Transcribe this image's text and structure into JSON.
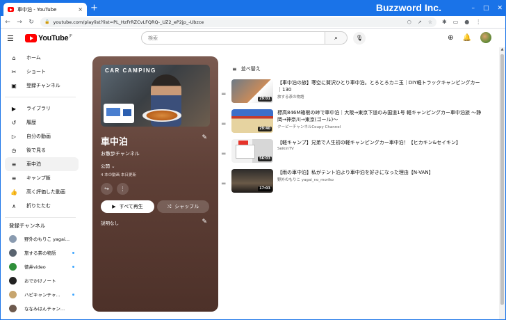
{
  "browser": {
    "tab_title": "車中泊 - YouTube",
    "tab_close": "×",
    "new_tab": "+",
    "brand": "Buzzword Inc.",
    "url": "youtube.com/playlist?list=PL_HzFrRZCvLFQRQ-_UZ2_eP2jp_-Ubzce",
    "lock": "🔒",
    "back": "←",
    "forward": "→",
    "reload": "↻",
    "min": "–",
    "max": "□",
    "close": "✕",
    "url_icons": [
      "⬡",
      "↗",
      "☆"
    ],
    "right_icons": [
      "✱",
      "▭",
      "●",
      "⋮"
    ]
  },
  "header": {
    "menu": "☰",
    "logo_text": "YouTube",
    "logo_sup": "JP",
    "search_placeholder": "検索",
    "search_icon": "⌕",
    "mic_icon": "🎙",
    "create_icon": "⊕",
    "bell_icon": "🔔"
  },
  "sidebar": {
    "main": [
      {
        "icon": "⌂",
        "label": "ホーム"
      },
      {
        "icon": "✂",
        "label": "ショート"
      },
      {
        "icon": "▣",
        "label": "登録チャンネル"
      }
    ],
    "library": [
      {
        "icon": "▶",
        "label": "ライブラリ"
      },
      {
        "icon": "↺",
        "label": "履歴"
      },
      {
        "icon": "▷",
        "label": "自分の動画"
      },
      {
        "icon": "◷",
        "label": "後で見る"
      },
      {
        "icon": "≡",
        "label": "車中泊"
      },
      {
        "icon": "≡",
        "label": "キャンプ飯"
      },
      {
        "icon": "👍",
        "label": "高く評価した動画"
      },
      {
        "icon": "∧",
        "label": "折りたたむ"
      }
    ],
    "subs_heading": "登録チャンネル",
    "subs": [
      {
        "label": "野外のもりこ yagai...",
        "color": "#8a9bb0",
        "dot": false
      },
      {
        "label": "旅する茶の物語",
        "color": "#5a6470",
        "dot": true
      },
      {
        "label": "徳井video",
        "color": "#2f8f3a",
        "dot": true
      },
      {
        "label": "おでかけノート",
        "color": "#222222",
        "dot": false
      },
      {
        "label": "ハピキャンチャ...",
        "color": "#c7a56e",
        "dot": true
      },
      {
        "label": "ななみはんチャン...",
        "color": "#6d5a4e",
        "dot": false
      }
    ]
  },
  "playlist": {
    "hero_text": "CAR CAMPING",
    "title": "車中泊",
    "edit_icon": "✎",
    "owner": "お散歩チャンネル",
    "privacy": "公開 ⌄",
    "meta": "4 本の動画 本日更新",
    "share_icon": "↪",
    "more_icon": "⋮",
    "play_all": "すべて再生",
    "play_icon": "▶",
    "shuffle": "シャッフル",
    "shuffle_icon": "⤮",
    "description": "説明なし"
  },
  "list": {
    "sort_icon": "≡",
    "sort_label": "並べ替え",
    "handle": "═",
    "videos": [
      {
        "title": "【車中泊の旅】寒空に贅沢ひとり車中泊。とろとろカニ玉｜DIY軽トラックキャンピングカー｜130",
        "channel": "旅する茶の物語",
        "duration": "29:01"
      },
      {
        "title": "標高846M箱根の峠で車中泊｜大阪→東京下道のみ国道1号 軽キャンピングカー車中泊旅 〜静岡→神奈川→東京(ゴール)〜",
        "channel": "クーピーチャンネルCoupy Channel",
        "duration": "29:40"
      },
      {
        "title": "【軽キャンプ】兄弟で人生初の軽キャンピングカー車中泊！【ヒカキン&セイキン】",
        "channel": "SeikinTV",
        "duration": "56:03"
      },
      {
        "title": "【雨の車中泊】私がテント泊より車中泊を好きになった理由【N-VAN】",
        "channel": "野外のもりこ yagai_no_moriko",
        "duration": "17:03"
      }
    ]
  }
}
